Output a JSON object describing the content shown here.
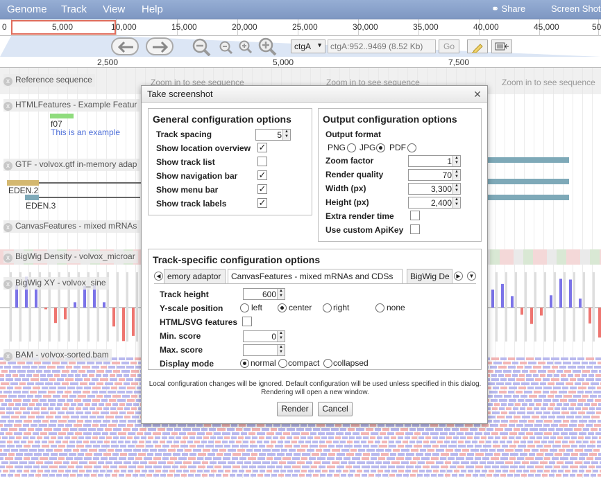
{
  "menubar": {
    "items": [
      "Genome",
      "Track",
      "View",
      "Help"
    ],
    "share_label": "Share",
    "screenshot_label": "Screen Shot"
  },
  "overview": {
    "labels": [
      "0",
      "5,000",
      "10,000",
      "15,000",
      "20,000",
      "25,000",
      "30,000",
      "35,000",
      "40,000",
      "45,000",
      "50,0"
    ]
  },
  "navbar": {
    "ref_seq": "ctgA",
    "location": "ctgA:952..9469 (8.52 Kb)",
    "go_label": "Go"
  },
  "ruler": {
    "labels": [
      "2,500",
      "5,000",
      "7,500"
    ]
  },
  "tracks": {
    "reference": {
      "label": "Reference sequence",
      "zoom_msg": "Zoom in to see sequence"
    },
    "html_features": {
      "label": "HTMLFeatures - Example Featur",
      "feature_name": "f07",
      "feature_desc": "This is an example"
    },
    "gtf": {
      "label": "GTF - volvox.gtf in-memory adap",
      "features": [
        "EDEN.1",
        "EDEN.2",
        "EDEN.3"
      ]
    },
    "canvas": {
      "label": "CanvasFeatures - mixed mRNAs"
    },
    "bigwig_density": {
      "label": "BigWig Density - volvox_microar"
    },
    "bigwig_xy": {
      "label": "BigWig XY - volvox_sine"
    },
    "bam": {
      "label": "BAM - volvox-sorted.bam"
    }
  },
  "dialog": {
    "title": "Take screenshot",
    "general": {
      "title": "General configuration options",
      "track_spacing_label": "Track spacing",
      "track_spacing_value": "5",
      "options": [
        {
          "label": "Show location overview",
          "checked": true
        },
        {
          "label": "Show track list",
          "checked": false
        },
        {
          "label": "Show navigation bar",
          "checked": true
        },
        {
          "label": "Show menu bar",
          "checked": true
        },
        {
          "label": "Show track labels",
          "checked": true
        }
      ]
    },
    "output": {
      "title": "Output configuration options",
      "format_label": "Output format",
      "formats": [
        {
          "label": "PNG",
          "selected": false
        },
        {
          "label": "JPG",
          "selected": true
        },
        {
          "label": "PDF",
          "selected": false
        }
      ],
      "zoom_factor_label": "Zoom factor",
      "zoom_factor_value": "1",
      "render_quality_label": "Render quality",
      "render_quality_value": "70",
      "width_label": "Width (px)",
      "width_value": "3,300",
      "height_label": "Height (px)",
      "height_value": "2,400",
      "extra_render_label": "Extra render time",
      "extra_render_checked": false,
      "custom_api_label": "Use custom ApiKey",
      "custom_api_checked": false
    },
    "track_specific": {
      "title": "Track-specific configuration options",
      "tabs": [
        "emory adaptor",
        "CanvasFeatures - mixed mRNAs and CDSs",
        "BigWig De"
      ],
      "active_tab": 1,
      "track_height_label": "Track height",
      "track_height_value": "600",
      "yscale_label": "Y-scale position",
      "yscale_options": [
        {
          "label": "left",
          "selected": false
        },
        {
          "label": "center",
          "selected": true
        },
        {
          "label": "right",
          "selected": false
        },
        {
          "label": "none",
          "selected": false
        }
      ],
      "html_svg_label": "HTML/SVG features",
      "html_svg_checked": false,
      "min_score_label": "Min. score",
      "min_score_value": "0",
      "max_score_label": "Max. score",
      "max_score_value": "",
      "display_mode_label": "Display mode",
      "display_modes": [
        {
          "label": "normal",
          "selected": true
        },
        {
          "label": "compact",
          "selected": false
        },
        {
          "label": "collapsed",
          "selected": false
        }
      ]
    },
    "note_line1": "Local configuration changes will be ignored. Default configuration will be used unless specified in this dialog.",
    "note_line2": "Rendering will open a new window.",
    "render_label": "Render",
    "cancel_label": "Cancel"
  },
  "colors": {
    "menubar": "#8aa3cd",
    "highlight": "#e06d5c",
    "bar_positive": "#7b73e8",
    "bar_negative": "#ee7570",
    "gtf_feature": "#7ea9b8",
    "html_feature": "#8fdc7d"
  }
}
